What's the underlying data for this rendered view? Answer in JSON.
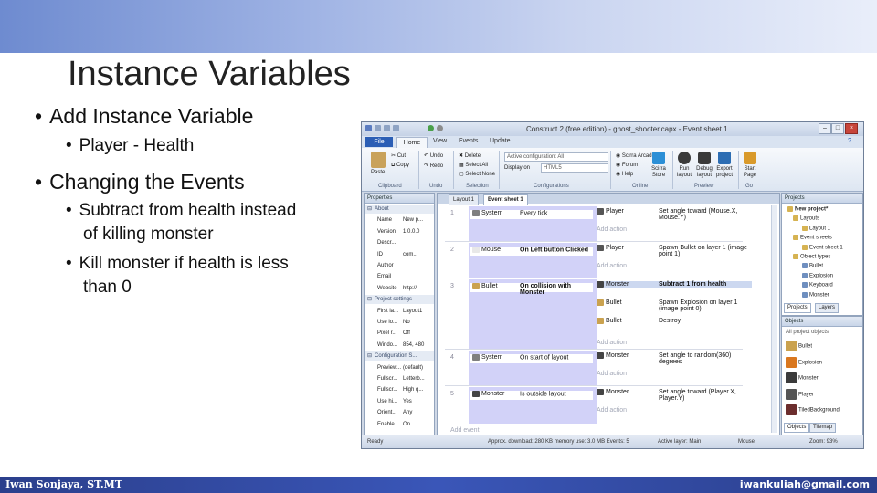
{
  "slide": {
    "title": "Instance Variables",
    "bullets": [
      {
        "text": "Add Instance Variable",
        "level": 1
      },
      {
        "text": "Player - Health",
        "level": 2
      },
      {
        "text": "Changing the Events",
        "level": 1
      },
      {
        "text": "Subtract from health instead",
        "level": 2
      },
      {
        "text": "of killing monster",
        "level": 2,
        "cont": true
      },
      {
        "text": "Kill monster if health is less",
        "level": 2
      },
      {
        "text": "than 0",
        "level": 2,
        "cont": true
      }
    ],
    "footer_left": "Iwan Sonjaya, ST.MT",
    "footer_right": "iwankuliah@gmail.com"
  },
  "app": {
    "title": "Construct 2 (free edition) - ghost_shooter.capx - Event sheet 1",
    "tabs": [
      "File",
      "Home",
      "View",
      "Events",
      "Update"
    ],
    "ribbon": {
      "clipboard": {
        "paste": "Paste",
        "cut": "Cut",
        "copy": "Copy",
        "group": "Clipboard"
      },
      "undo": {
        "undo": "Undo",
        "redo": "Redo",
        "group": "Undo"
      },
      "selection": {
        "delete": "Delete",
        "select_all": "Select All",
        "select_none": "Select None",
        "group": "Selection"
      },
      "configurations": {
        "active": "Active configuration: All",
        "display": "Display on",
        "value": "HTML5",
        "group": "Configurations"
      },
      "online": {
        "arcade": "Scirra Arcade",
        "forum": "Forum",
        "help": "Help",
        "store": "Scirra Store",
        "group": "Online"
      },
      "preview": {
        "run": "Run layout",
        "debug": "Debug layout",
        "export": "Export project",
        "group": "Preview"
      },
      "go": {
        "start": "Start Page",
        "group": "Go"
      }
    },
    "properties": {
      "title": "Properties",
      "rows": [
        {
          "name": "About",
          "value": "",
          "cat": true
        },
        {
          "name": "Name",
          "value": "New p..."
        },
        {
          "name": "Version",
          "value": "1.0.0.0"
        },
        {
          "name": "Descr...",
          "value": ""
        },
        {
          "name": "ID",
          "value": "com..."
        },
        {
          "name": "Author",
          "value": ""
        },
        {
          "name": "Email",
          "value": ""
        },
        {
          "name": "Website",
          "value": "http://"
        },
        {
          "name": "Project settings",
          "value": "",
          "cat": true
        },
        {
          "name": "First la...",
          "value": "Layout1"
        },
        {
          "name": "Use lo...",
          "value": "No"
        },
        {
          "name": "Pixel r...",
          "value": "Off"
        },
        {
          "name": "Windo...",
          "value": "854, 480"
        },
        {
          "name": "Configuration S...",
          "value": "",
          "cat": true
        },
        {
          "name": "Preview...",
          "value": "(default)"
        },
        {
          "name": "Fullscr...",
          "value": "Letterb..."
        },
        {
          "name": "Fullscr...",
          "value": "High q..."
        },
        {
          "name": "Use hi...",
          "value": "Yes"
        },
        {
          "name": "Orient...",
          "value": "Any"
        },
        {
          "name": "Enable...",
          "value": "On"
        }
      ]
    },
    "event_tabs": [
      "Layout 1",
      "Event sheet 1"
    ],
    "events": [
      {
        "num": "1",
        "object": "System",
        "condition": "Every tick",
        "actions": [
          {
            "object": "Player",
            "text": "Set angle toward (Mouse.X, Mouse.Y)"
          }
        ],
        "add": "Add action"
      },
      {
        "num": "2",
        "object": "Mouse",
        "condition": "On Left button Clicked",
        "actions": [
          {
            "object": "Player",
            "text": "Spawn Bullet on layer 1 (image point 1)"
          }
        ],
        "add": "Add action"
      },
      {
        "num": "3",
        "object": "Bullet",
        "condition": "On collision with Monster",
        "actions": [
          {
            "object": "Monster",
            "text": "Subtract 1 from health"
          },
          {
            "object": "Bullet",
            "text": "Spawn Explosion on layer 1 (image point 0)"
          },
          {
            "object": "Bullet",
            "text": "Destroy"
          }
        ],
        "add": "Add action"
      },
      {
        "num": "4",
        "object": "System",
        "condition": "On start of layout",
        "actions": [
          {
            "object": "Monster",
            "text": "Set angle to random(360) degrees"
          }
        ],
        "add": "Add action"
      },
      {
        "num": "5",
        "object": "Monster",
        "condition": "Is outside layout",
        "actions": [
          {
            "object": "Monster",
            "text": "Set angle toward (Player.X, Player.Y)"
          }
        ],
        "add": "Add action"
      }
    ],
    "add_event": "Add event",
    "projects": {
      "title": "Projects",
      "items": [
        "New project*",
        "Layouts",
        "Layout 1",
        "Event sheets",
        "Event sheet 1",
        "Object types",
        "Bullet",
        "Explosion",
        "Keyboard",
        "Monster"
      ]
    },
    "panel_tabs": [
      "Projects",
      "Layers"
    ],
    "objects": {
      "title": "Objects",
      "filter": "All project objects",
      "items": [
        "Bullet",
        "Explosion",
        "Monster",
        "Player",
        "TiledBackground"
      ]
    },
    "object_tabs": [
      "Objects",
      "Tilemap"
    ],
    "status": {
      "ready": "Ready",
      "download": "Approx. download: 280 KB  memory use: 3.0 MB  Events: 5",
      "layer": "Active layer: Main",
      "mouse": "Mouse",
      "zoom": "Zoom: 93%"
    }
  },
  "colors": {
    "accent": "#2b5eb5",
    "condition_bg": "#d2d2f8",
    "footer": "#2b3f8c"
  }
}
